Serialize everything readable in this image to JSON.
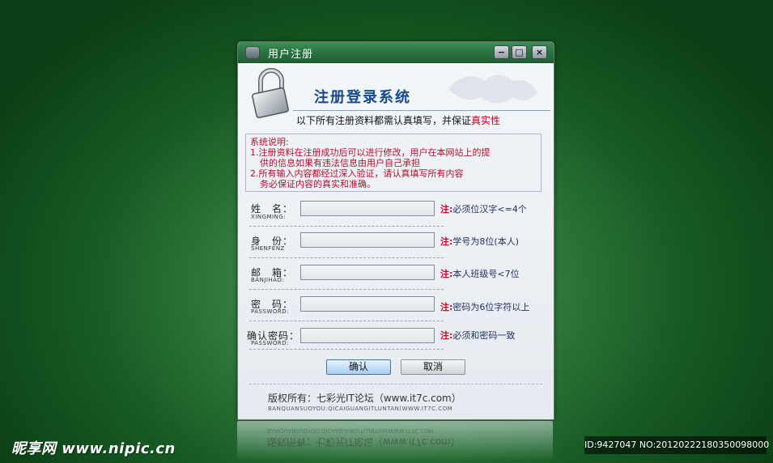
{
  "window": {
    "title": "用户注册",
    "controls": {
      "minimize": "−",
      "maximize": "□",
      "close": "×"
    }
  },
  "banner": {
    "title": "注册登录系统",
    "notice_prefix": "以下所有注册资料都需认真填写，并保证",
    "notice_highlight": "真实性"
  },
  "description": {
    "heading": "系统说明:",
    "lines": [
      "1.注册资料在注册成功后可以进行修改，用户在本网站上的提",
      "  供的信息如果有违法信息由用户自己承担",
      "2.所有输入内容都经过深入验证，请认真填写所有内容",
      "  务必保证内容的真实和准确。"
    ]
  },
  "form": {
    "fields": [
      {
        "label": "姓　名：",
        "sublabel": "XINGMING:",
        "value": "",
        "note_tag": "注:",
        "note": "必须位汉字<=4个"
      },
      {
        "label": "身　份：",
        "sublabel": "SHENFENZ",
        "value": "",
        "note_tag": "注:",
        "note": "学号为8位(本人)"
      },
      {
        "label": "邮　箱：",
        "sublabel": "BANJIHAO:",
        "value": "",
        "note_tag": "注:",
        "note": "本人班级号<7位"
      },
      {
        "label": "密　码：",
        "sublabel": "PASSWORD:",
        "value": "",
        "note_tag": "注:",
        "note": "密码为6位字符以上"
      },
      {
        "label": "确认密码：",
        "sublabel": "PASSWORD:",
        "value": "",
        "note_tag": "注:",
        "note": "必须和密码一致"
      }
    ],
    "confirm_label": "确认",
    "cancel_label": "取消"
  },
  "footer": {
    "copyright": "版权所有：七彩光IT论坛（www.it7c.com）",
    "copyright_sub": "BANQUANSUOYOU:QICAIGUANGITLUNTAN(WWW.IT7C.COM"
  },
  "watermark": {
    "left": "昵享网 www.nipic.cn",
    "right": "ID:9427047 NO:20120222180350098000"
  },
  "icons": {
    "lock": "padlock-icon"
  },
  "colors": {
    "accent_green": "#2a7340",
    "title_blue": "#174a8a",
    "note_red": "#d4001e"
  }
}
